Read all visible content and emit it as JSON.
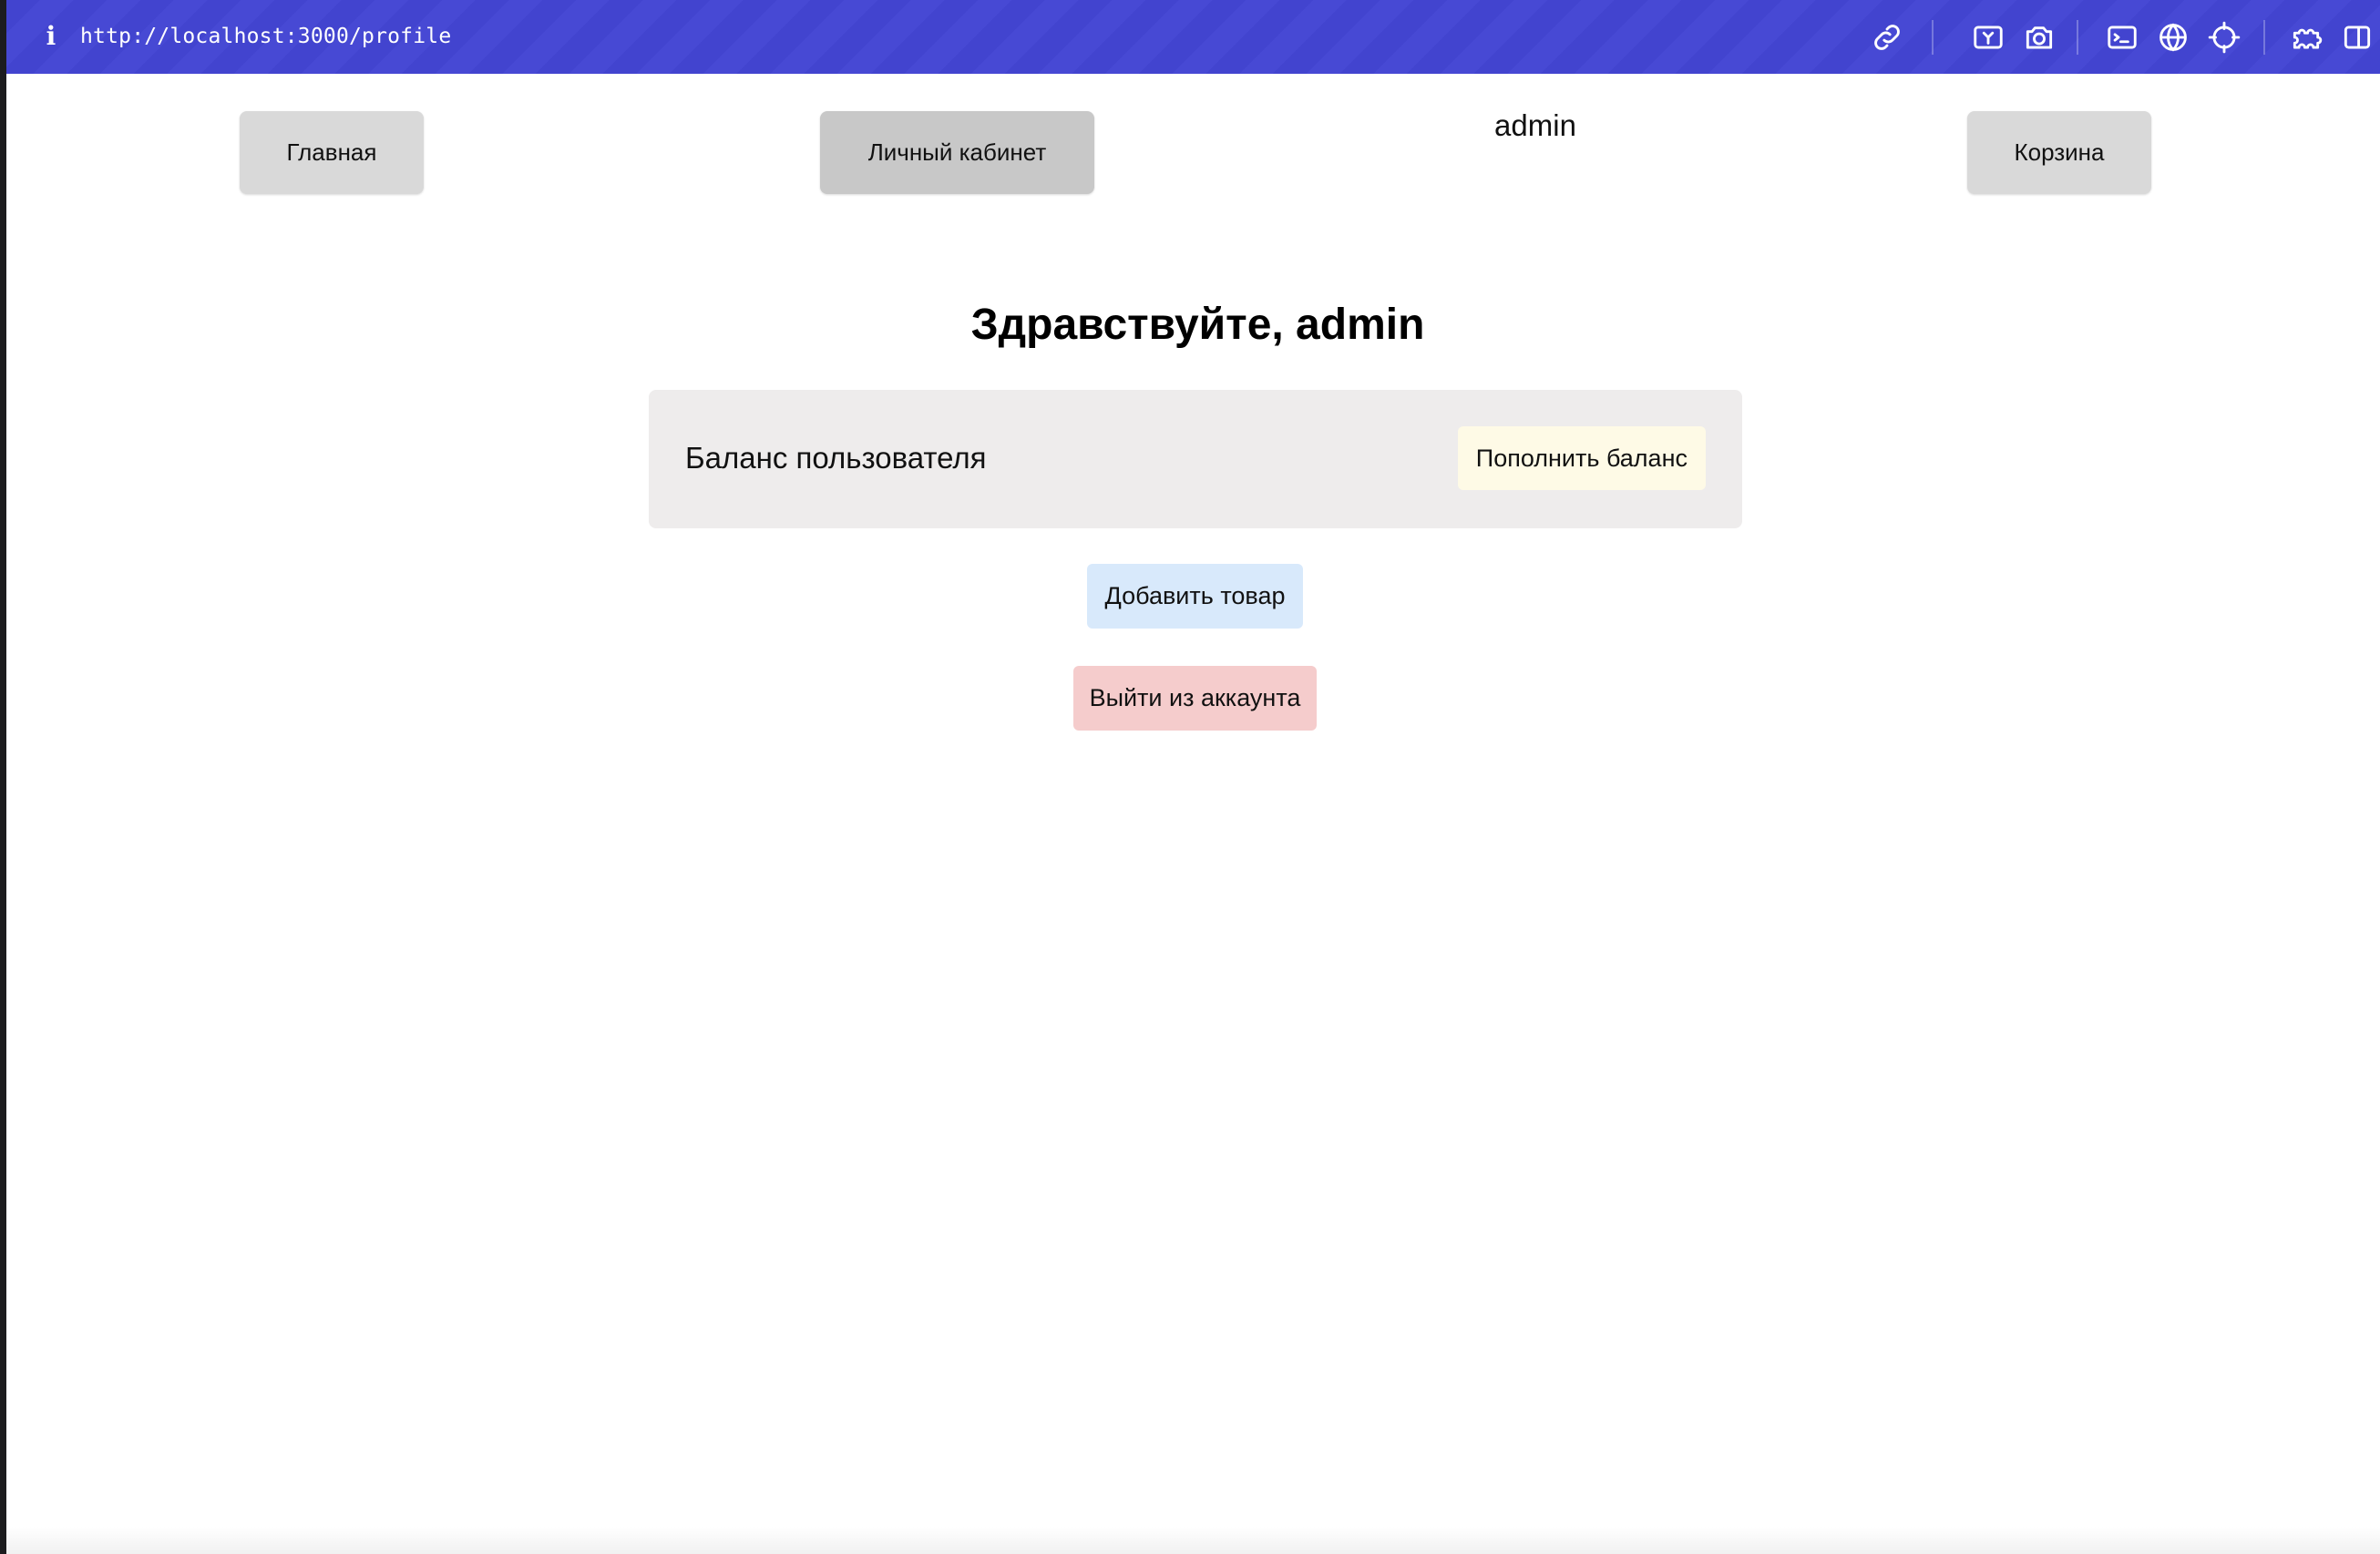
{
  "browser": {
    "url": "http://localhost:3000/profile",
    "icons": [
      "info-icon",
      "link-icon",
      "screenshot-area-icon",
      "camera-icon",
      "terminal-icon",
      "globe-icon",
      "crosshair-icon",
      "extensions-icon",
      "sidebar-icon"
    ],
    "accent": "#4244cf"
  },
  "nav": {
    "home": "Главная",
    "profile": "Личный кабинет",
    "username": "admin",
    "cart": "Корзина"
  },
  "main": {
    "greeting": "Здравствуйте, admin",
    "balance_label": "Баланс пользователя",
    "topup_button": "Пополнить баланс",
    "add_product_button": "Добавить товар",
    "logout_button": "Выйти из аккаунта"
  },
  "colors": {
    "nav_button": "#d9d9d9",
    "card": "#eeecec",
    "topup": "#fefae6",
    "add_product": "#d8e9fb",
    "logout": "#f5cccc"
  }
}
